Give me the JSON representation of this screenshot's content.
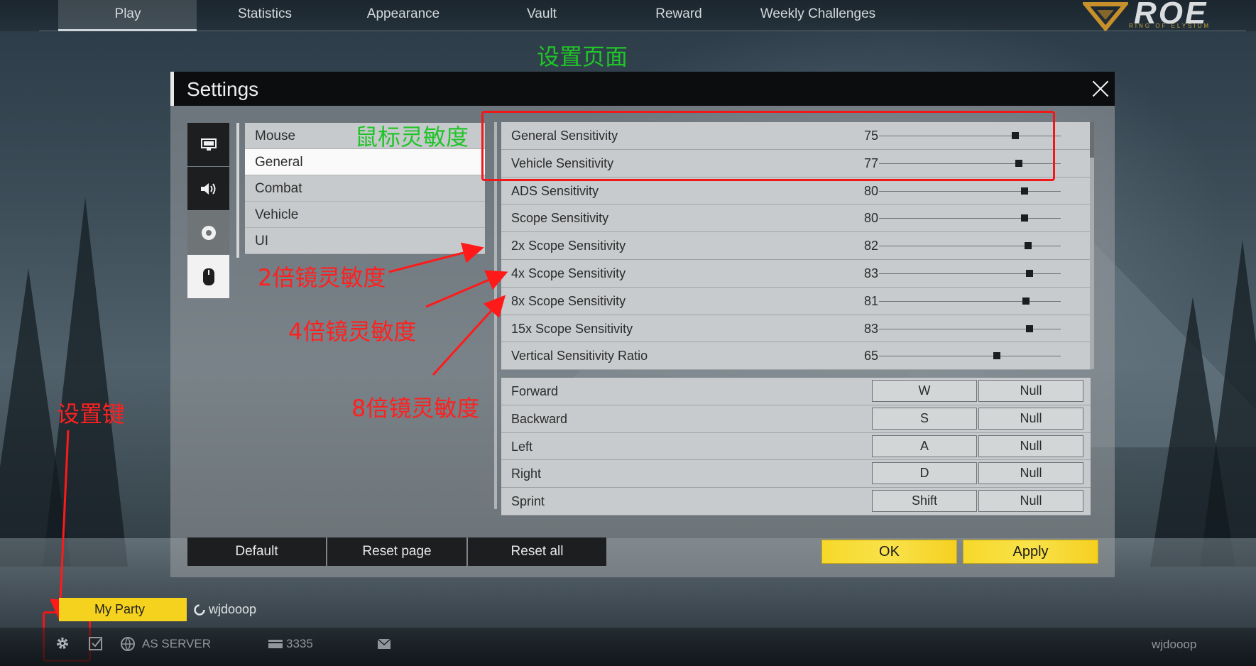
{
  "top_nav": {
    "tabs": [
      "Play",
      "Statistics",
      "Appearance",
      "Vault",
      "Reward",
      "Weekly Challenges"
    ],
    "active_tab": "Play",
    "logo_text": "ROE",
    "logo_subtitle": "RING OF ELYSIUM"
  },
  "annotations": {
    "settings_page": "设置页面",
    "mouse_sensitivity": "鼠标灵敏度",
    "scope_2x": "2倍镜灵敏度",
    "scope_4x": "4倍镜灵敏度",
    "scope_8x": "8倍镜灵敏度",
    "settings_key": "设置键"
  },
  "settings": {
    "title": "Settings",
    "categories": [
      "Mouse",
      "General",
      "Combat",
      "Vehicle",
      "UI"
    ],
    "active_category": "General",
    "side_icons": [
      "monitor-icon",
      "speaker-icon",
      "gamepad-icon",
      "mouse-icon"
    ],
    "sensitivity_rows": [
      {
        "label": "General Sensitivity",
        "value": "75",
        "level": 0.75
      },
      {
        "label": "Vehicle Sensitivity",
        "value": "77",
        "level": 0.77
      },
      {
        "label": "ADS Sensitivity",
        "value": "80",
        "level": 0.8
      },
      {
        "label": "Scope Sensitivity",
        "value": "80",
        "level": 0.8
      },
      {
        "label": "2x Scope Sensitivity",
        "value": "82",
        "level": 0.82
      },
      {
        "label": "4x Scope Sensitivity",
        "value": "83",
        "level": 0.83
      },
      {
        "label": "8x Scope Sensitivity",
        "value": "81",
        "level": 0.81
      },
      {
        "label": "15x Scope Sensitivity",
        "value": "83",
        "level": 0.83
      },
      {
        "label": "Vertical Sensitivity Ratio",
        "value": "65",
        "level": 0.65
      }
    ],
    "key_rows": [
      {
        "label": "Forward",
        "primary": "W",
        "secondary": "Null"
      },
      {
        "label": "Backward",
        "primary": "S",
        "secondary": "Null"
      },
      {
        "label": "Left",
        "primary": "A",
        "secondary": "Null"
      },
      {
        "label": "Right",
        "primary": "D",
        "secondary": "Null"
      },
      {
        "label": "Sprint",
        "primary": "Shift",
        "secondary": "Null"
      }
    ],
    "buttons": {
      "default": "Default",
      "reset_page": "Reset page",
      "reset_all": "Reset all",
      "ok": "OK",
      "apply": "Apply"
    }
  },
  "bottom_bar": {
    "party_label": "My Party",
    "party_member": "wjdooop",
    "server": "AS SERVER",
    "currency": "3335",
    "username": "wjdooop"
  },
  "colors": {
    "accent_yellow": "#f5d21e",
    "annotation_red": "#ff2020",
    "annotation_green": "#20c428",
    "dark_panel": "#1c1e20"
  }
}
